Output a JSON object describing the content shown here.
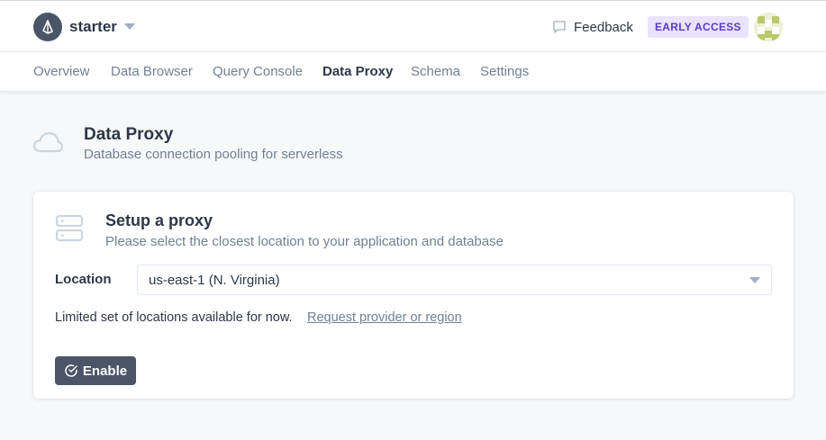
{
  "header": {
    "project_name": "starter",
    "feedback_label": "Feedback",
    "badge_label": "EARLY ACCESS"
  },
  "tabs": [
    {
      "label": "Overview",
      "active": false
    },
    {
      "label": "Data Browser",
      "active": false
    },
    {
      "label": "Query Console",
      "active": false
    },
    {
      "label": "Data Proxy",
      "active": true
    },
    {
      "label": "Schema",
      "active": false
    },
    {
      "label": "Settings",
      "active": false
    }
  ],
  "page": {
    "title": "Data Proxy",
    "subtitle": "Database connection pooling for serverless"
  },
  "card": {
    "title": "Setup a proxy",
    "subtitle": "Please select the closest location to your application and database",
    "location_label": "Location",
    "location_value": "us-east-1 (N. Virginia)",
    "limited_text": "Limited set of locations available for now.",
    "request_link": "Request provider or region",
    "enable_label": "Enable"
  },
  "colors": {
    "primary_button": "#4a5568",
    "badge_bg": "#e9e3fb",
    "badge_text": "#5b3cc4"
  }
}
